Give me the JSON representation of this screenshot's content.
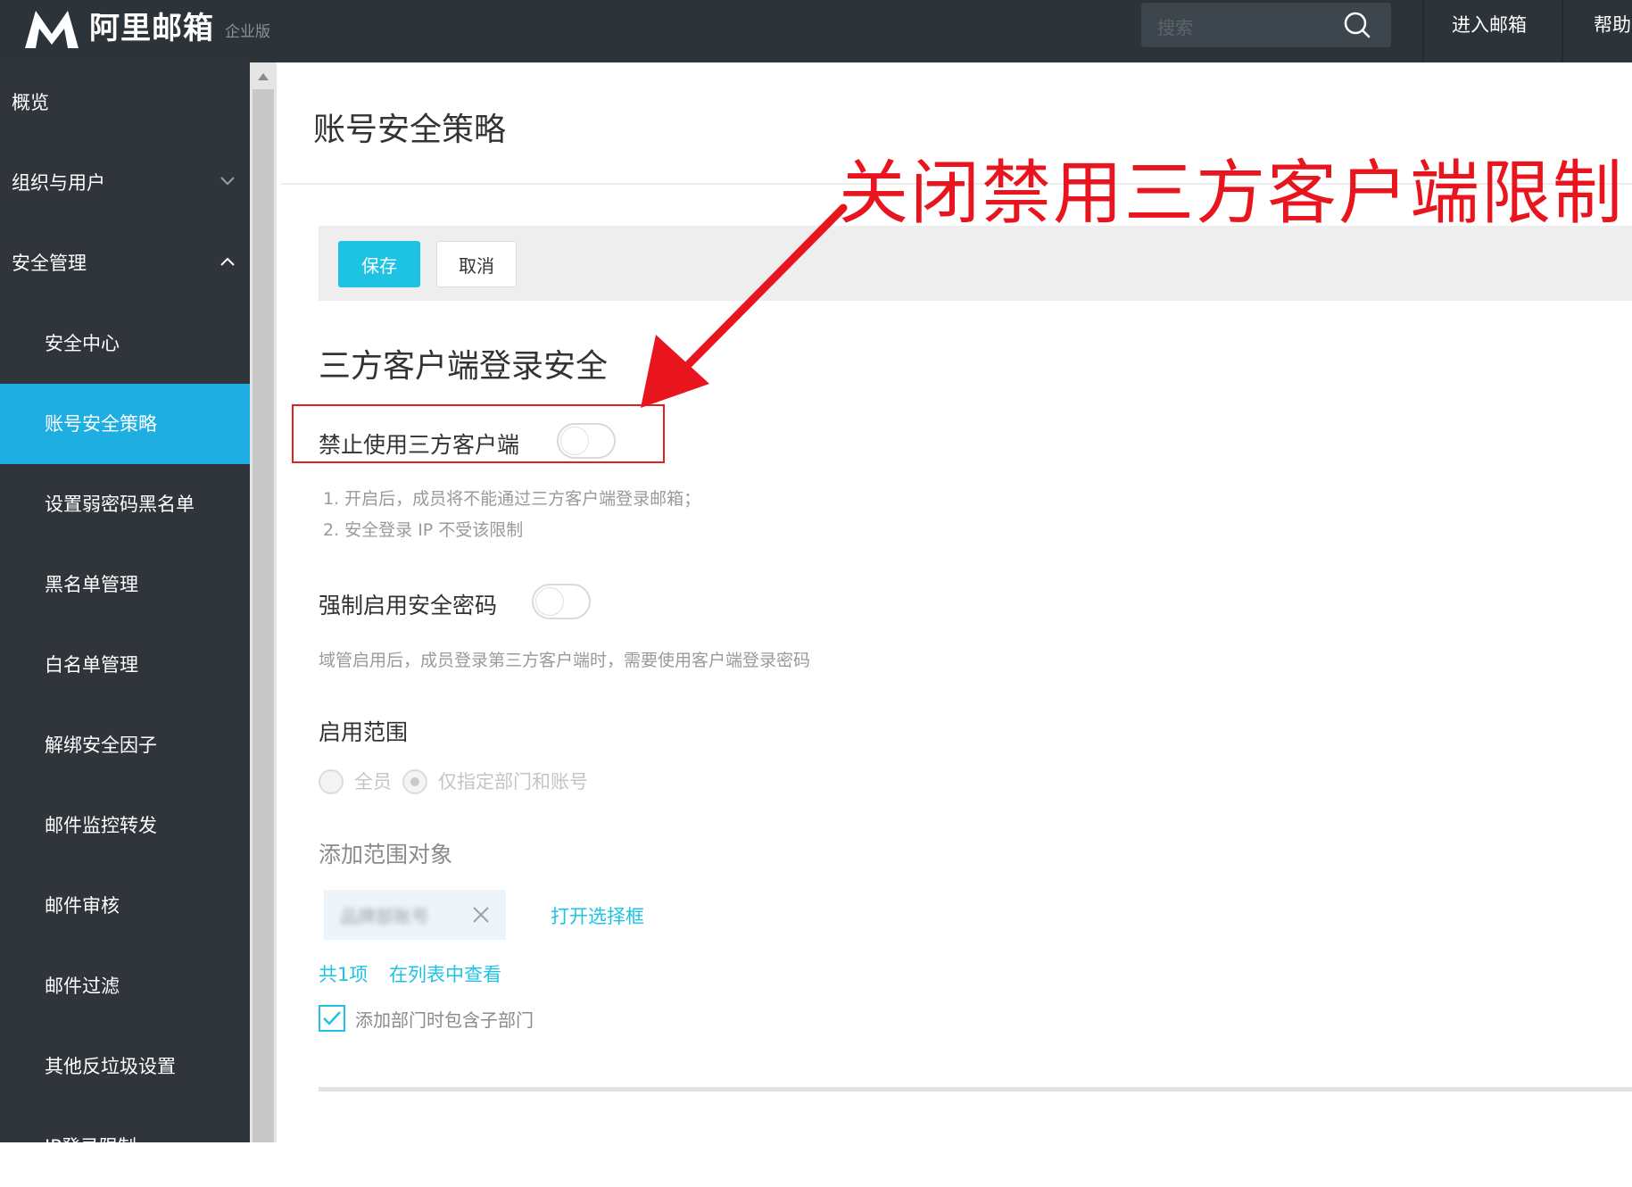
{
  "header": {
    "brand": "阿里邮箱",
    "edition": "企业版",
    "search_placeholder": "搜索",
    "nav": [
      "进入邮箱",
      "帮助"
    ]
  },
  "sidebar": {
    "items": [
      {
        "label": "概览",
        "level": 1
      },
      {
        "label": "组织与用户",
        "level": 1,
        "chevron": "down"
      },
      {
        "label": "安全管理",
        "level": 1,
        "chevron": "up"
      },
      {
        "label": "安全中心",
        "level": 2
      },
      {
        "label": "账号安全策略",
        "level": 2,
        "active": true
      },
      {
        "label": "设置弱密码黑名单",
        "level": 2
      },
      {
        "label": "黑名单管理",
        "level": 2
      },
      {
        "label": "白名单管理",
        "level": 2
      },
      {
        "label": "解绑安全因子",
        "level": 2
      },
      {
        "label": "邮件监控转发",
        "level": 2
      },
      {
        "label": "邮件审核",
        "level": 2
      },
      {
        "label": "邮件过滤",
        "level": 2
      },
      {
        "label": "其他反垃圾设置",
        "level": 2
      },
      {
        "label": "IP登录限制",
        "level": 2
      }
    ]
  },
  "main": {
    "title": "账号安全策略",
    "toolbar": {
      "save": "保存",
      "cancel": "取消"
    },
    "section_title": "三方客户端登录安全",
    "setting1": {
      "label": "禁止使用三方客户端",
      "enabled": false,
      "hints": [
        "1. 开启后，成员将不能通过三方客户端登录邮箱；",
        "2. 安全登录 IP 不受该限制"
      ]
    },
    "setting2": {
      "label": "强制启用安全密码",
      "enabled": false,
      "hint": "域管启用后，成员登录第三方客户端时，需要使用客户端登录密码"
    },
    "scope": {
      "label": "启用范围",
      "options": [
        "全员",
        "仅指定部门和账号"
      ],
      "selected": "仅指定部门和账号"
    },
    "targets": {
      "label": "添加范围对象",
      "chip_text": "品牌部账号",
      "open_selector": "打开选择框",
      "count": "共1项",
      "view_in_list": "在列表中查看",
      "include_sub_label": "添加部门时包含子部门",
      "include_sub_checked": true
    }
  },
  "annotation": {
    "text": "关闭禁用三方客户端限制",
    "color": "#e8141e"
  },
  "colors": {
    "topbar": "#2c3339",
    "sidebar": "#2f353b",
    "accent": "#1eaee2",
    "save_button": "#1ec3e3"
  }
}
